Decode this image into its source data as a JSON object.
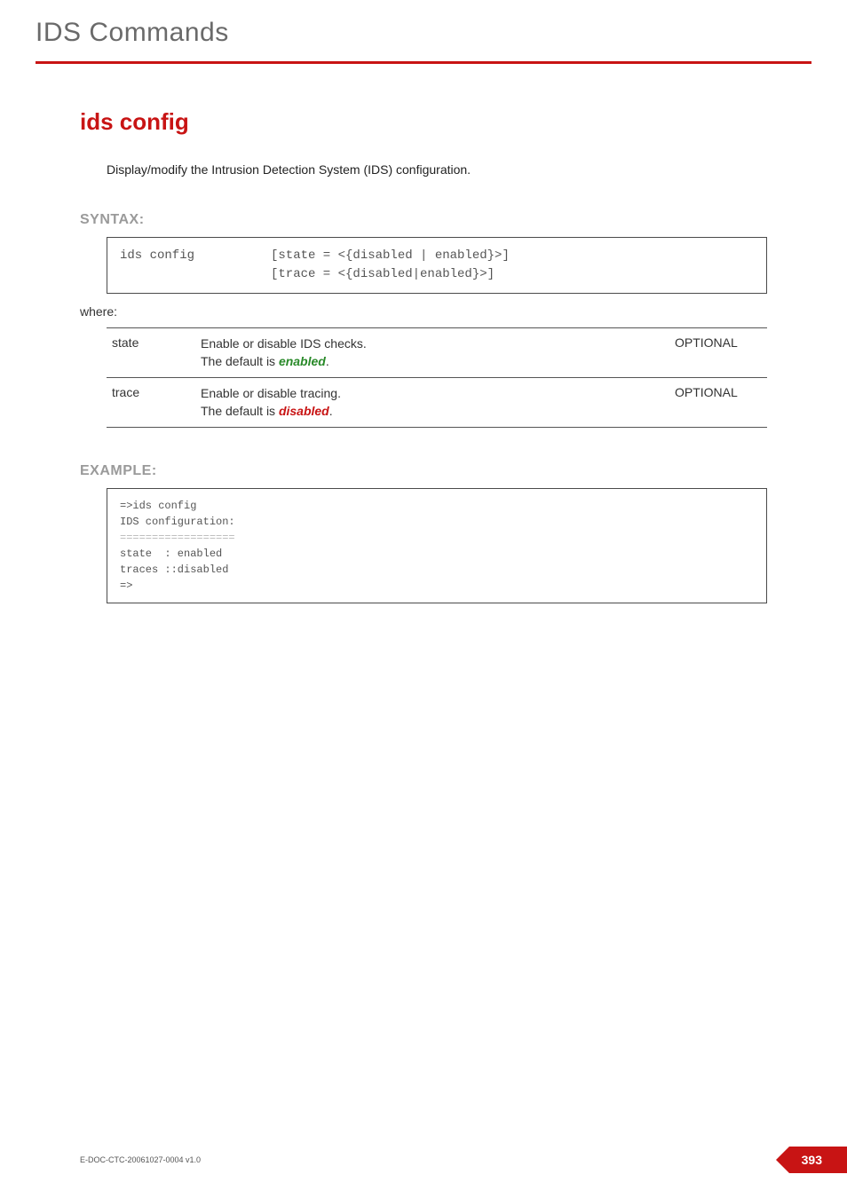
{
  "header": {
    "running_head": "IDS Commands"
  },
  "title": "ids config",
  "description": "Display/modify the Intrusion Detection System (IDS) configuration.",
  "syntax": {
    "label": "SYNTAX:",
    "command": "ids config",
    "args_line1": "[state = <{disabled | enabled}>]",
    "args_line2": "[trace = <{disabled|enabled}>]"
  },
  "where_label": "where:",
  "params": [
    {
      "name": "state",
      "desc": "Enable or disable IDS checks.",
      "default_prefix": "The default is ",
      "default_value": "enabled",
      "default_class": "default-enabled",
      "req": "OPTIONAL"
    },
    {
      "name": "trace",
      "desc": "Enable or disable tracing.",
      "default_prefix": "The default is ",
      "default_value": "disabled",
      "default_class": "default-disabled",
      "req": "OPTIONAL"
    }
  ],
  "example": {
    "label": "EXAMPLE:",
    "lines": {
      "l1": "=>ids config",
      "l2": "IDS configuration:",
      "l3": "==================",
      "l4": "state  : enabled",
      "l5": "traces ::disabled",
      "l6": "=>"
    }
  },
  "footer": {
    "docref": "E-DOC-CTC-20061027-0004 v1.0",
    "page": "393"
  }
}
